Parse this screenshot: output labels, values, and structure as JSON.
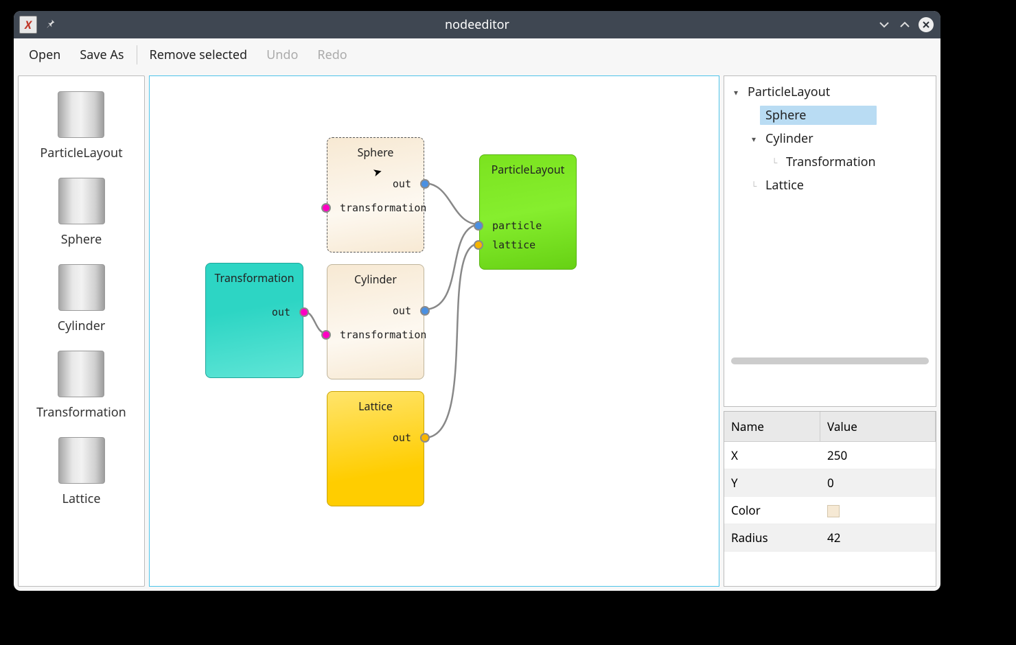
{
  "window": {
    "title": "nodeeditor",
    "app_icon_letter": "X"
  },
  "toolbar": {
    "open": "Open",
    "save_as": "Save As",
    "remove_selected": "Remove selected",
    "undo": "Undo",
    "redo": "Redo"
  },
  "palette": [
    {
      "label": "ParticleLayout"
    },
    {
      "label": "Sphere"
    },
    {
      "label": "Cylinder"
    },
    {
      "label": "Transformation"
    },
    {
      "label": "Lattice"
    }
  ],
  "nodes": {
    "sphere": {
      "title": "Sphere",
      "out": "out",
      "transformation": "transformation"
    },
    "cylinder": {
      "title": "Cylinder",
      "out": "out",
      "transformation": "transformation"
    },
    "lattice": {
      "title": "Lattice",
      "out": "out"
    },
    "trans": {
      "title": "Transformation",
      "out": "out"
    },
    "pl": {
      "title": "ParticleLayout",
      "particle": "particle",
      "lattice": "lattice"
    }
  },
  "tree": {
    "root": "ParticleLayout",
    "sphere": "Sphere",
    "cylinder": "Cylinder",
    "transformation": "Transformation",
    "lattice": "Lattice"
  },
  "properties": {
    "header_name": "Name",
    "header_value": "Value",
    "rows": [
      {
        "name": "X",
        "value": "250"
      },
      {
        "name": "Y",
        "value": "0"
      },
      {
        "name": "Color",
        "value": ""
      },
      {
        "name": "Radius",
        "value": "42"
      }
    ],
    "color_swatch": "#f6e9d4"
  }
}
